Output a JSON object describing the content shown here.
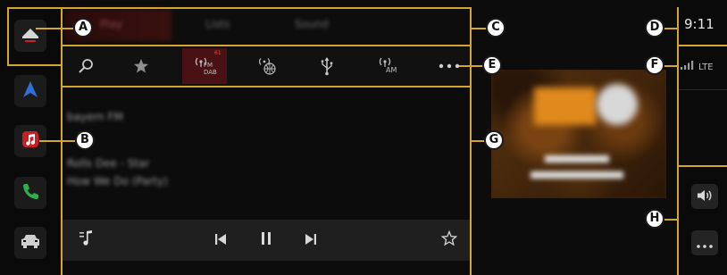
{
  "status": {
    "time": "9:11",
    "network": "LTE"
  },
  "sources": {
    "tabs": [
      "Play",
      "Lists",
      "Sound"
    ]
  },
  "toolbar": {
    "badge": "61",
    "fm_dab_label": "FM DAB",
    "am_label": "AM",
    "more_label": "•••"
  },
  "now_playing": {
    "station": "bayern FM",
    "line1": "Rolls Dee - Star",
    "line2": "How We Do (Party)"
  },
  "callouts": {
    "a": "A",
    "b": "B",
    "c": "C",
    "d": "D",
    "e": "E",
    "f": "F",
    "g": "G",
    "h": "H"
  },
  "colors": {
    "accent": "#d3a72f",
    "background": "#0c0c0c",
    "music_red": "#c81e25",
    "phone_green": "#2fae4b",
    "nav_blue": "#2f6fd6"
  },
  "icons": {
    "home": "home-icon",
    "navigation": "navigation-arrow-icon",
    "music": "music-note-icon",
    "phone": "phone-icon",
    "car": "car-icon",
    "search": "search-icon",
    "favorite": "star-icon",
    "fm_dab": "fm-dab-radio-icon",
    "online_radio": "online-radio-icon",
    "usb": "usb-icon",
    "am": "am-radio-icon",
    "more": "more-icon",
    "signal": "signal-icon",
    "volume": "volume-icon",
    "playlist": "playlist-icon",
    "previous": "skip-previous-icon",
    "pause": "pause-icon",
    "next": "skip-next-icon"
  }
}
